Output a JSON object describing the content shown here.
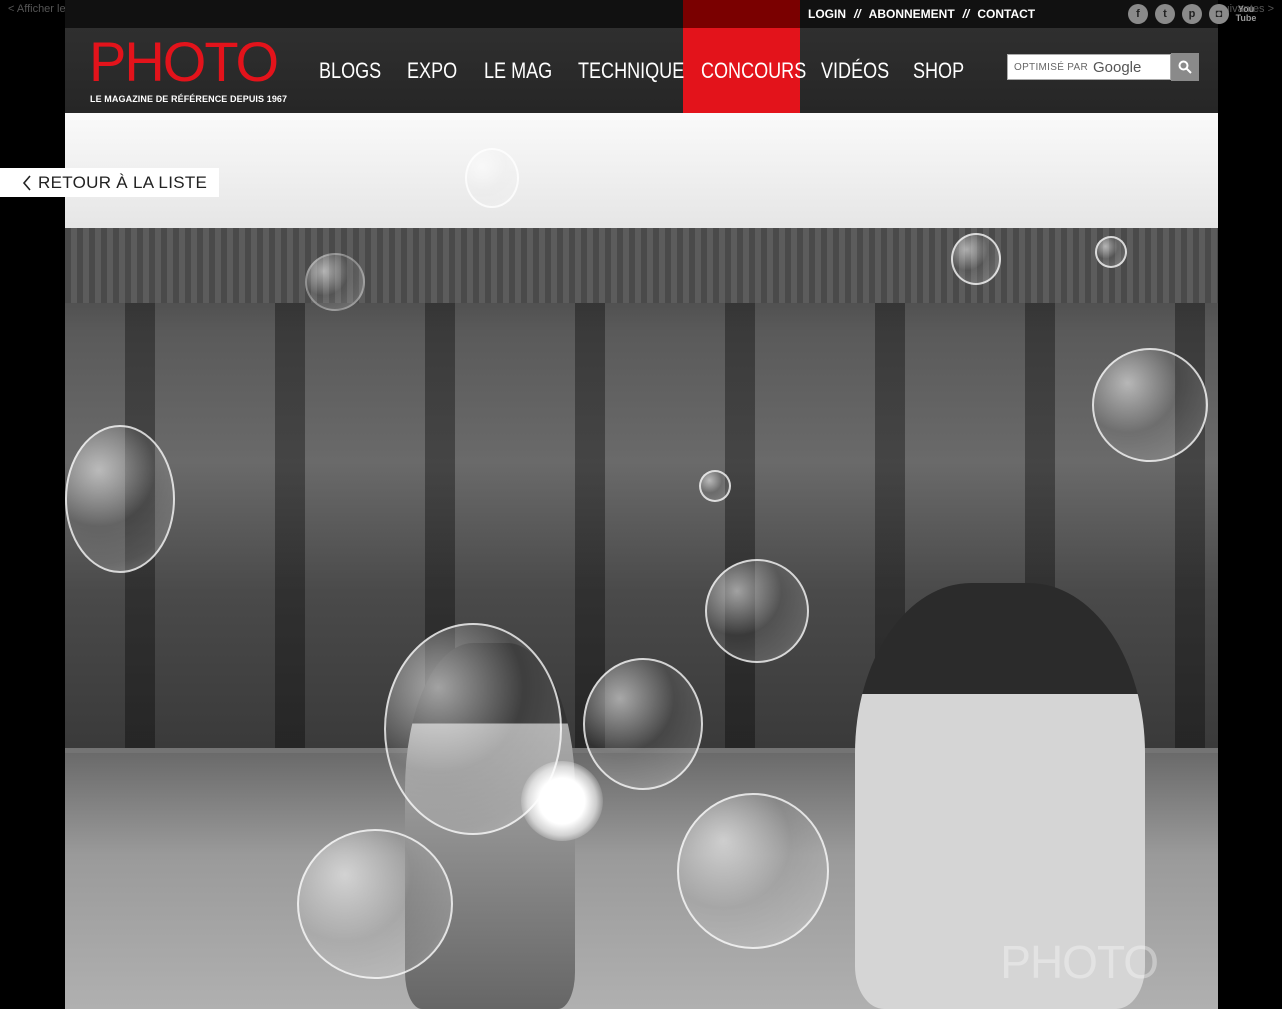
{
  "edge": {
    "prev": "< Afficher les",
    "next": "suivantes >"
  },
  "util_nav": {
    "login": "LOGIN",
    "sep": "//",
    "abonnement": "ABONNEMENT",
    "contact": "CONTACT"
  },
  "social": {
    "facebook": "f",
    "twitter": "t",
    "pinterest": "p",
    "instagram": "◘",
    "youtube": "You Tube"
  },
  "brand": {
    "logo": "PHOTO",
    "tagline": "LE MAGAZINE DE RÉFÉRENCE DEPUIS 1967",
    "accent": "#e3131b"
  },
  "main_nav": {
    "items": [
      {
        "label": "BLOGS"
      },
      {
        "label": "EXPO"
      },
      {
        "label": "LE MAG"
      },
      {
        "label": "TECHNIQUE"
      },
      {
        "label": "CONCOURS",
        "active": true
      },
      {
        "label": "VIDÉOS"
      },
      {
        "label": "SHOP"
      }
    ]
  },
  "search": {
    "prefix": "OPTIMISÉ PAR",
    "brand": "Google"
  },
  "back": {
    "label": "RETOUR À LA LISTE"
  },
  "photo": {
    "watermark": "PHOTO"
  }
}
